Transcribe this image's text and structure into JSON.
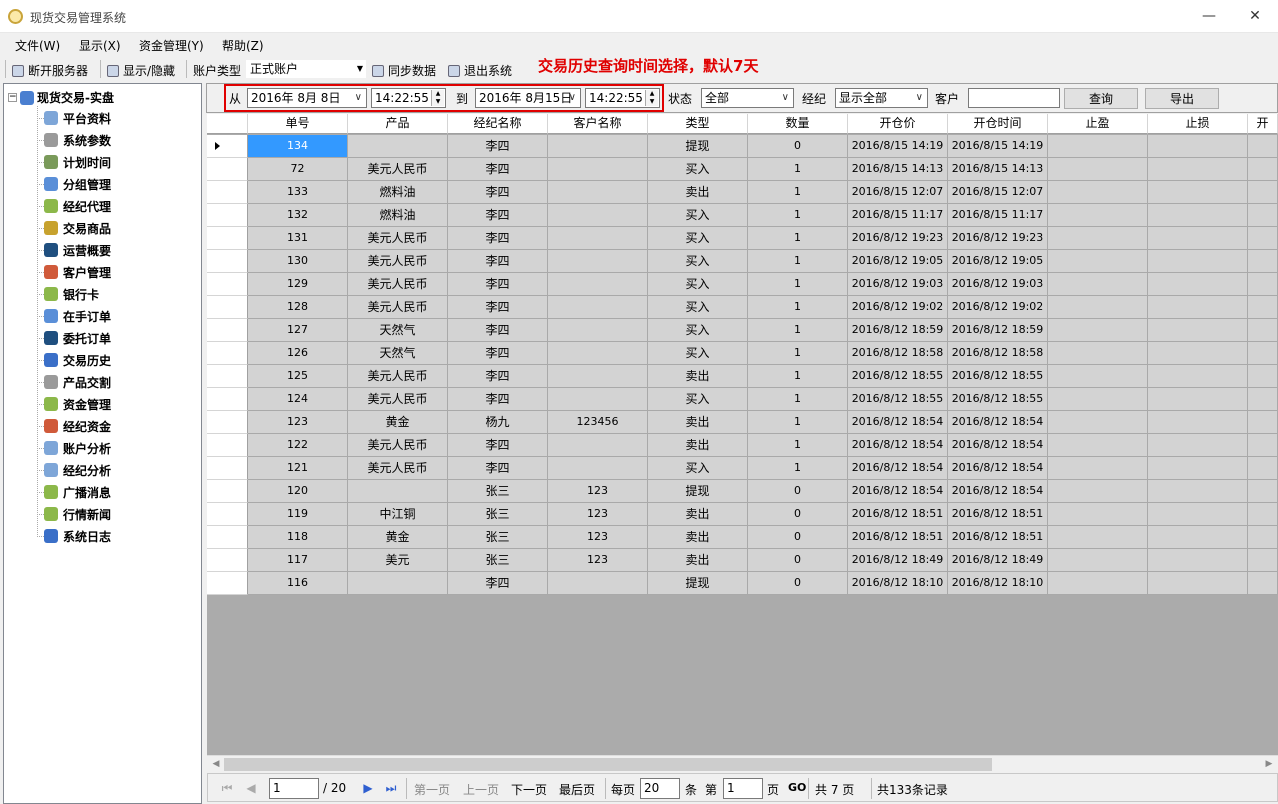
{
  "window": {
    "title": "现货交易管理系统",
    "min": "—",
    "max": "☐",
    "close": "✕"
  },
  "menu": [
    "文件(W)",
    "显示(X)",
    "资金管理(Y)",
    "帮助(Z)"
  ],
  "toolbar": {
    "disconnect": "断开服务器",
    "toggle": "显示/隐藏",
    "acct_label": "账户类型",
    "acct_value": "正式账户",
    "sync": "同步数据",
    "exit": "退出系统"
  },
  "annotation": "交易历史查询时间选择，默认7天",
  "tree": {
    "root": "现货交易-实盘",
    "items": [
      {
        "label": "平台资料",
        "icon": "window-icon"
      },
      {
        "label": "系统参数",
        "icon": "gears-icon"
      },
      {
        "label": "计划时间",
        "icon": "clock-icon"
      },
      {
        "label": "分组管理",
        "icon": "globe-icon"
      },
      {
        "label": "经纪代理",
        "icon": "users-icon"
      },
      {
        "label": "交易商品",
        "icon": "goods-icon"
      },
      {
        "label": "运营概要",
        "icon": "earth-icon"
      },
      {
        "label": "客户管理",
        "icon": "user-icon"
      },
      {
        "label": "银行卡",
        "icon": "card-icon"
      },
      {
        "label": "在手订单",
        "icon": "globe-icon"
      },
      {
        "label": "委托订单",
        "icon": "earth-icon"
      },
      {
        "label": "交易历史",
        "icon": "book-icon"
      },
      {
        "label": "产品交割",
        "icon": "gears-icon"
      },
      {
        "label": "资金管理",
        "icon": "users-icon"
      },
      {
        "label": "经纪资金",
        "icon": "user-icon"
      },
      {
        "label": "账户分析",
        "icon": "window-icon"
      },
      {
        "label": "经纪分析",
        "icon": "window-icon"
      },
      {
        "label": "广播消息",
        "icon": "users-icon"
      },
      {
        "label": "行情新闻",
        "icon": "users-icon"
      },
      {
        "label": "系统日志",
        "icon": "book-icon"
      }
    ]
  },
  "filter": {
    "from_label": "从",
    "from_date": "2016年 8月 8日",
    "from_time": "14:22:55",
    "to_label": "到",
    "to_date": "2016年 8月15日",
    "to_time": "14:22:55",
    "status_label": "状态",
    "status_value": "全部",
    "broker_label": "经纪",
    "broker_value": "显示全部",
    "client_label": "客户",
    "client_value": "",
    "query": "查询",
    "export": "导出"
  },
  "table": {
    "columns": [
      "单号",
      "产品",
      "经纪名称",
      "客户名称",
      "类型",
      "数量",
      "开仓价",
      "开仓时间",
      "止盈",
      "止损",
      "开"
    ],
    "rows": [
      [
        "134",
        "",
        "李四",
        "",
        "提现",
        "0",
        "2016/8/15 14:19",
        "2016/8/15 14:19",
        "",
        "",
        ""
      ],
      [
        "72",
        "美元人民币",
        "李四",
        "",
        "买入",
        "1",
        "2016/8/15 14:13",
        "2016/8/15 14:13",
        "",
        "",
        ""
      ],
      [
        "133",
        "燃料油",
        "李四",
        "",
        "卖出",
        "1",
        "2016/8/15 12:07",
        "2016/8/15 12:07",
        "",
        "",
        ""
      ],
      [
        "132",
        "燃料油",
        "李四",
        "",
        "买入",
        "1",
        "2016/8/15 11:17",
        "2016/8/15 11:17",
        "",
        "",
        ""
      ],
      [
        "131",
        "美元人民币",
        "李四",
        "",
        "买入",
        "1",
        "2016/8/12 19:23",
        "2016/8/12 19:23",
        "",
        "",
        ""
      ],
      [
        "130",
        "美元人民币",
        "李四",
        "",
        "买入",
        "1",
        "2016/8/12 19:05",
        "2016/8/12 19:05",
        "",
        "",
        ""
      ],
      [
        "129",
        "美元人民币",
        "李四",
        "",
        "买入",
        "1",
        "2016/8/12 19:03",
        "2016/8/12 19:03",
        "",
        "",
        ""
      ],
      [
        "128",
        "美元人民币",
        "李四",
        "",
        "买入",
        "1",
        "2016/8/12 19:02",
        "2016/8/12 19:02",
        "",
        "",
        ""
      ],
      [
        "127",
        "天然气",
        "李四",
        "",
        "买入",
        "1",
        "2016/8/12 18:59",
        "2016/8/12 18:59",
        "",
        "",
        ""
      ],
      [
        "126",
        "天然气",
        "李四",
        "",
        "买入",
        "1",
        "2016/8/12 18:58",
        "2016/8/12 18:58",
        "",
        "",
        ""
      ],
      [
        "125",
        "美元人民币",
        "李四",
        "",
        "卖出",
        "1",
        "2016/8/12 18:55",
        "2016/8/12 18:55",
        "",
        "",
        ""
      ],
      [
        "124",
        "美元人民币",
        "李四",
        "",
        "买入",
        "1",
        "2016/8/12 18:55",
        "2016/8/12 18:55",
        "",
        "",
        ""
      ],
      [
        "123",
        "黄金",
        "杨九",
        "123456",
        "卖出",
        "1",
        "2016/8/12 18:54",
        "2016/8/12 18:54",
        "",
        "",
        ""
      ],
      [
        "122",
        "美元人民币",
        "李四",
        "",
        "卖出",
        "1",
        "2016/8/12 18:54",
        "2016/8/12 18:54",
        "",
        "",
        ""
      ],
      [
        "121",
        "美元人民币",
        "李四",
        "",
        "买入",
        "1",
        "2016/8/12 18:54",
        "2016/8/12 18:54",
        "",
        "",
        ""
      ],
      [
        "120",
        "",
        "张三",
        "123",
        "提现",
        "0",
        "2016/8/12 18:54",
        "2016/8/12 18:54",
        "",
        "",
        ""
      ],
      [
        "119",
        "中江铜",
        "张三",
        "123",
        "卖出",
        "0",
        "2016/8/12 18:51",
        "2016/8/12 18:51",
        "",
        "",
        ""
      ],
      [
        "118",
        "黄金",
        "张三",
        "123",
        "卖出",
        "0",
        "2016/8/12 18:51",
        "2016/8/12 18:51",
        "",
        "",
        ""
      ],
      [
        "117",
        "美元",
        "张三",
        "123",
        "卖出",
        "0",
        "2016/8/12 18:49",
        "2016/8/12 18:49",
        "",
        "",
        ""
      ],
      [
        "116",
        "",
        "李四",
        "",
        "提现",
        "0",
        "2016/8/12 18:10",
        "2016/8/12 18:10",
        "",
        "",
        ""
      ]
    ]
  },
  "pager": {
    "page": "1",
    "total_pages": "/ 20",
    "first": "第一页",
    "prev": "上一页",
    "next": "下一页",
    "last": "最后页",
    "per_page_label": "每页",
    "per_page": "20",
    "per_page_unit": "条",
    "goto_label": "第",
    "goto_page": "1",
    "goto_unit": "页",
    "go": "GO",
    "pages_summary": "共 7 页",
    "records_summary": "共133条记录"
  },
  "colors": {
    "annotation": "#e00000",
    "selected": "#3399ff",
    "cell_bg": "#d3d3d3"
  }
}
